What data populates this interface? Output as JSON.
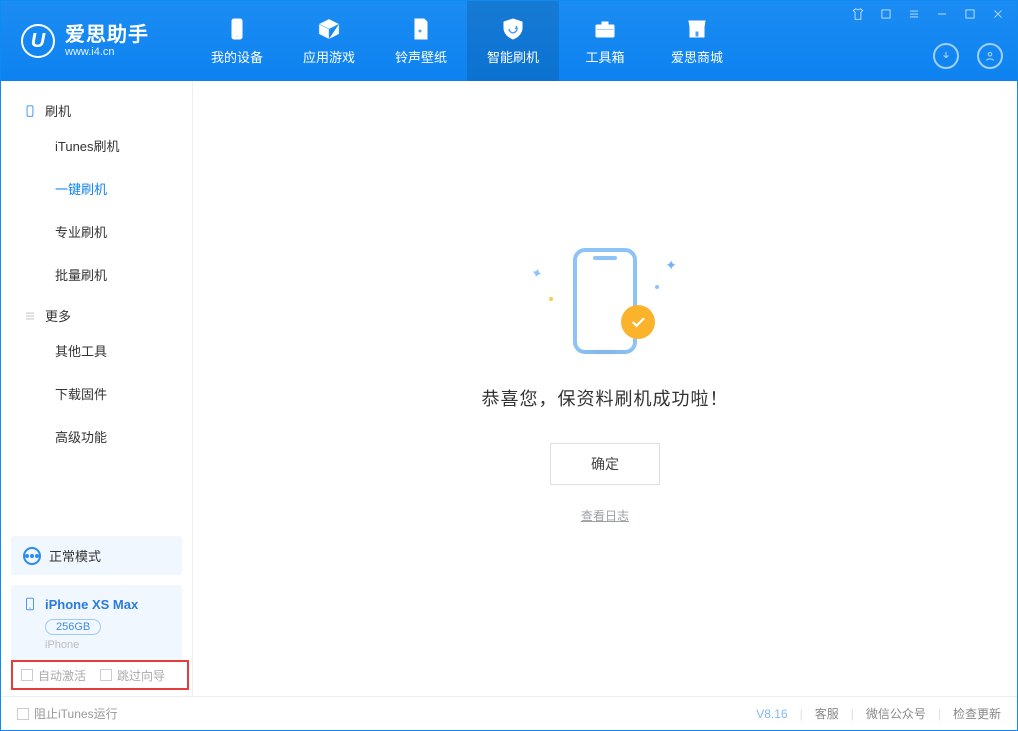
{
  "app": {
    "title": "爱思助手",
    "subtitle": "www.i4.cn",
    "logo_letter": "U"
  },
  "tabs": {
    "device": "我的设备",
    "apps": "应用游戏",
    "ringtone": "铃声壁纸",
    "flash": "智能刷机",
    "toolbox": "工具箱",
    "store": "爱思商城"
  },
  "sidebar": {
    "group_flash": "刷机",
    "items_flash": [
      "iTunes刷机",
      "一键刷机",
      "专业刷机",
      "批量刷机"
    ],
    "group_more": "更多",
    "items_more": [
      "其他工具",
      "下载固件",
      "高级功能"
    ],
    "active_item": "一键刷机"
  },
  "mode": {
    "label": "正常模式"
  },
  "device": {
    "name": "iPhone XS Max",
    "storage": "256GB",
    "type": "iPhone"
  },
  "result": {
    "message": "恭喜您，保资料刷机成功啦！",
    "ok": "确定",
    "view_log": "查看日志"
  },
  "options": {
    "auto_activate": "自动激活",
    "skip_guide": "跳过向导"
  },
  "footer": {
    "stop_itunes": "阻止iTunes运行",
    "version": "V8.16",
    "support": "客服",
    "wechat": "微信公众号",
    "update": "检查更新"
  }
}
